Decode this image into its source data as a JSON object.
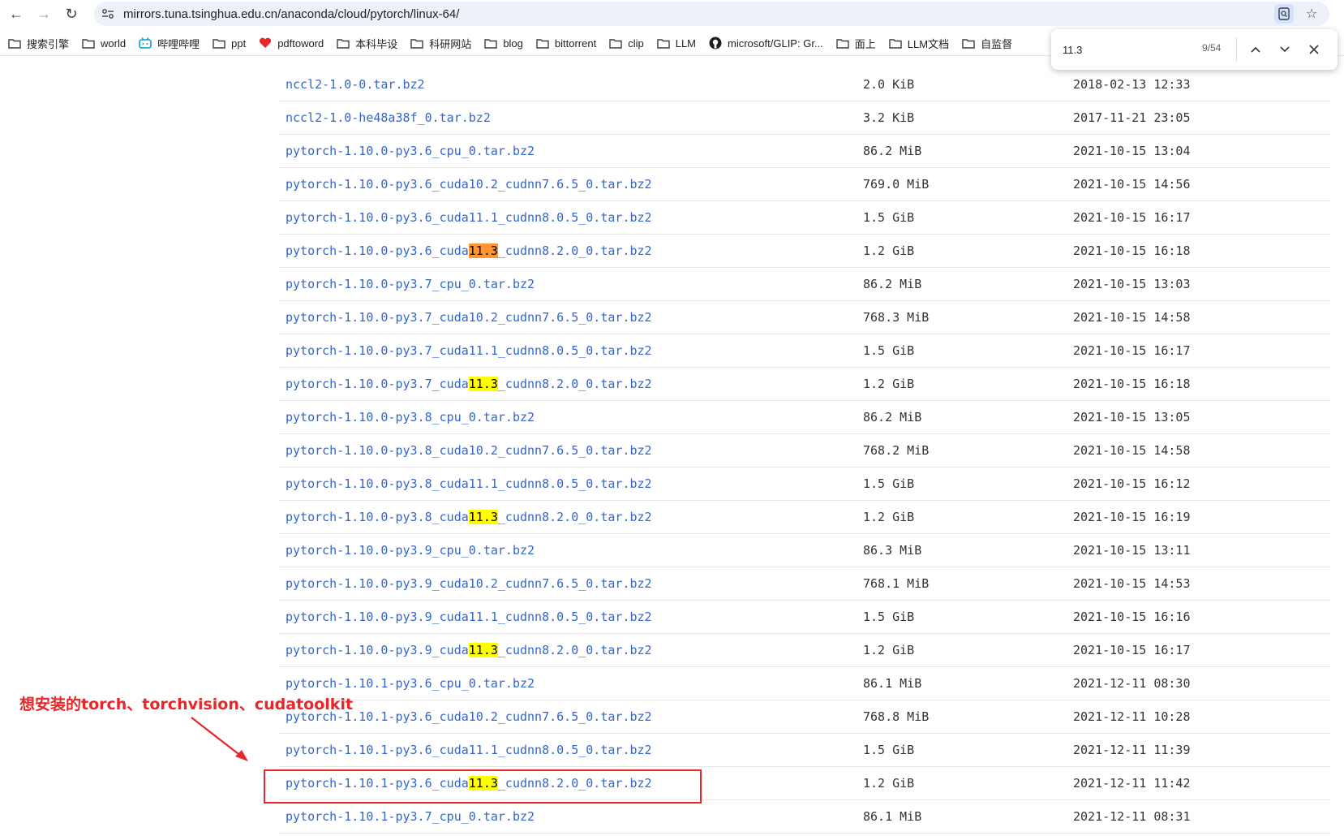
{
  "browser": {
    "url": "mirrors.tuna.tsinghua.edu.cn/anaconda/cloud/pytorch/linux-64/"
  },
  "bookmarks": [
    {
      "label": "搜索引擎",
      "icon": "folder-icon"
    },
    {
      "label": "world",
      "icon": "folder-icon"
    },
    {
      "label": "哔哩哔哩",
      "icon": "bilibili-icon"
    },
    {
      "label": "ppt",
      "icon": "folder-icon"
    },
    {
      "label": "pdftoword",
      "icon": "heart-icon"
    },
    {
      "label": "本科毕设",
      "icon": "folder-icon"
    },
    {
      "label": "科研网站",
      "icon": "folder-icon"
    },
    {
      "label": "blog",
      "icon": "folder-icon"
    },
    {
      "label": "bittorrent",
      "icon": "folder-icon"
    },
    {
      "label": "clip",
      "icon": "folder-icon"
    },
    {
      "label": "LLM",
      "icon": "folder-icon"
    },
    {
      "label": "microsoft/GLIP: Gr...",
      "icon": "github-icon"
    },
    {
      "label": "面上",
      "icon": "folder-icon"
    },
    {
      "label": "LLM文档",
      "icon": "folder-icon"
    },
    {
      "label": "自监督",
      "icon": "folder-icon"
    }
  ],
  "find": {
    "query": "11.3",
    "count": "9/54"
  },
  "files": [
    {
      "pre": "nccl2-1.0-0.tar.bz2",
      "hl": "",
      "post": "",
      "hl_type": "",
      "size": "2.0 KiB",
      "date": "2018-02-13 12:33"
    },
    {
      "pre": "nccl2-1.0-he48a38f_0.tar.bz2",
      "hl": "",
      "post": "",
      "hl_type": "",
      "size": "3.2 KiB",
      "date": "2017-11-21 23:05"
    },
    {
      "pre": "pytorch-1.10.0-py3.6_cpu_0.tar.bz2",
      "hl": "",
      "post": "",
      "hl_type": "",
      "size": "86.2 MiB",
      "date": "2021-10-15 13:04"
    },
    {
      "pre": "pytorch-1.10.0-py3.6_cuda10.2_cudnn7.6.5_0.tar.bz2",
      "hl": "",
      "post": "",
      "hl_type": "",
      "size": "769.0 MiB",
      "date": "2021-10-15 14:56"
    },
    {
      "pre": "pytorch-1.10.0-py3.6_cuda11.1_cudnn8.0.5_0.tar.bz2",
      "hl": "",
      "post": "",
      "hl_type": "",
      "size": "1.5 GiB",
      "date": "2021-10-15 16:17"
    },
    {
      "pre": "pytorch-1.10.0-py3.6_cuda",
      "hl": "11.3",
      "post": "_cudnn8.2.0_0.tar.bz2",
      "hl_type": "current",
      "size": "1.2 GiB",
      "date": "2021-10-15 16:18"
    },
    {
      "pre": "pytorch-1.10.0-py3.7_cpu_0.tar.bz2",
      "hl": "",
      "post": "",
      "hl_type": "",
      "size": "86.2 MiB",
      "date": "2021-10-15 13:03"
    },
    {
      "pre": "pytorch-1.10.0-py3.7_cuda10.2_cudnn7.6.5_0.tar.bz2",
      "hl": "",
      "post": "",
      "hl_type": "",
      "size": "768.3 MiB",
      "date": "2021-10-15 14:58"
    },
    {
      "pre": "pytorch-1.10.0-py3.7_cuda11.1_cudnn8.0.5_0.tar.bz2",
      "hl": "",
      "post": "",
      "hl_type": "",
      "size": "1.5 GiB",
      "date": "2021-10-15 16:17"
    },
    {
      "pre": "pytorch-1.10.0-py3.7_cuda",
      "hl": "11.3",
      "post": "_cudnn8.2.0_0.tar.bz2",
      "hl_type": "match",
      "size": "1.2 GiB",
      "date": "2021-10-15 16:18"
    },
    {
      "pre": "pytorch-1.10.0-py3.8_cpu_0.tar.bz2",
      "hl": "",
      "post": "",
      "hl_type": "",
      "size": "86.2 MiB",
      "date": "2021-10-15 13:05"
    },
    {
      "pre": "pytorch-1.10.0-py3.8_cuda10.2_cudnn7.6.5_0.tar.bz2",
      "hl": "",
      "post": "",
      "hl_type": "",
      "size": "768.2 MiB",
      "date": "2021-10-15 14:58"
    },
    {
      "pre": "pytorch-1.10.0-py3.8_cuda11.1_cudnn8.0.5_0.tar.bz2",
      "hl": "",
      "post": "",
      "hl_type": "",
      "size": "1.5 GiB",
      "date": "2021-10-15 16:12"
    },
    {
      "pre": "pytorch-1.10.0-py3.8_cuda",
      "hl": "11.3",
      "post": "_cudnn8.2.0_0.tar.bz2",
      "hl_type": "match",
      "size": "1.2 GiB",
      "date": "2021-10-15 16:19"
    },
    {
      "pre": "pytorch-1.10.0-py3.9_cpu_0.tar.bz2",
      "hl": "",
      "post": "",
      "hl_type": "",
      "size": "86.3 MiB",
      "date": "2021-10-15 13:11"
    },
    {
      "pre": "pytorch-1.10.0-py3.9_cuda10.2_cudnn7.6.5_0.tar.bz2",
      "hl": "",
      "post": "",
      "hl_type": "",
      "size": "768.1 MiB",
      "date": "2021-10-15 14:53"
    },
    {
      "pre": "pytorch-1.10.0-py3.9_cuda11.1_cudnn8.0.5_0.tar.bz2",
      "hl": "",
      "post": "",
      "hl_type": "",
      "size": "1.5 GiB",
      "date": "2021-10-15 16:16"
    },
    {
      "pre": "pytorch-1.10.0-py3.9_cuda",
      "hl": "11.3",
      "post": "_cudnn8.2.0_0.tar.bz2",
      "hl_type": "match",
      "size": "1.2 GiB",
      "date": "2021-10-15 16:17"
    },
    {
      "pre": "pytorch-1.10.1-py3.6_cpu_0.tar.bz2",
      "hl": "",
      "post": "",
      "hl_type": "",
      "size": "86.1 MiB",
      "date": "2021-12-11 08:30"
    },
    {
      "pre": "pytorch-1.10.1-py3.6_cuda10.2_cudnn7.6.5_0.tar.bz2",
      "hl": "",
      "post": "",
      "hl_type": "",
      "size": "768.8 MiB",
      "date": "2021-12-11 10:28"
    },
    {
      "pre": "pytorch-1.10.1-py3.6_cuda11.1_cudnn8.0.5_0.tar.bz2",
      "hl": "",
      "post": "",
      "hl_type": "",
      "size": "1.5 GiB",
      "date": "2021-12-11 11:39"
    },
    {
      "pre": "pytorch-1.10.1-py3.6_cuda",
      "hl": "11.3",
      "post": "_cudnn8.2.0_0.tar.bz2",
      "hl_type": "match",
      "size": "1.2 GiB",
      "date": "2021-12-11 11:42"
    },
    {
      "pre": "pytorch-1.10.1-py3.7_cpu_0.tar.bz2",
      "hl": "",
      "post": "",
      "hl_type": "",
      "size": "86.1 MiB",
      "date": "2021-12-11 08:31"
    }
  ],
  "annotation": {
    "text": "想安装的torch、torchvision、cudatoolkit",
    "color": "#e8262a"
  },
  "colors": {
    "link": "#3366cc",
    "find_current": "#ff9632",
    "find_match": "#ffff00"
  }
}
